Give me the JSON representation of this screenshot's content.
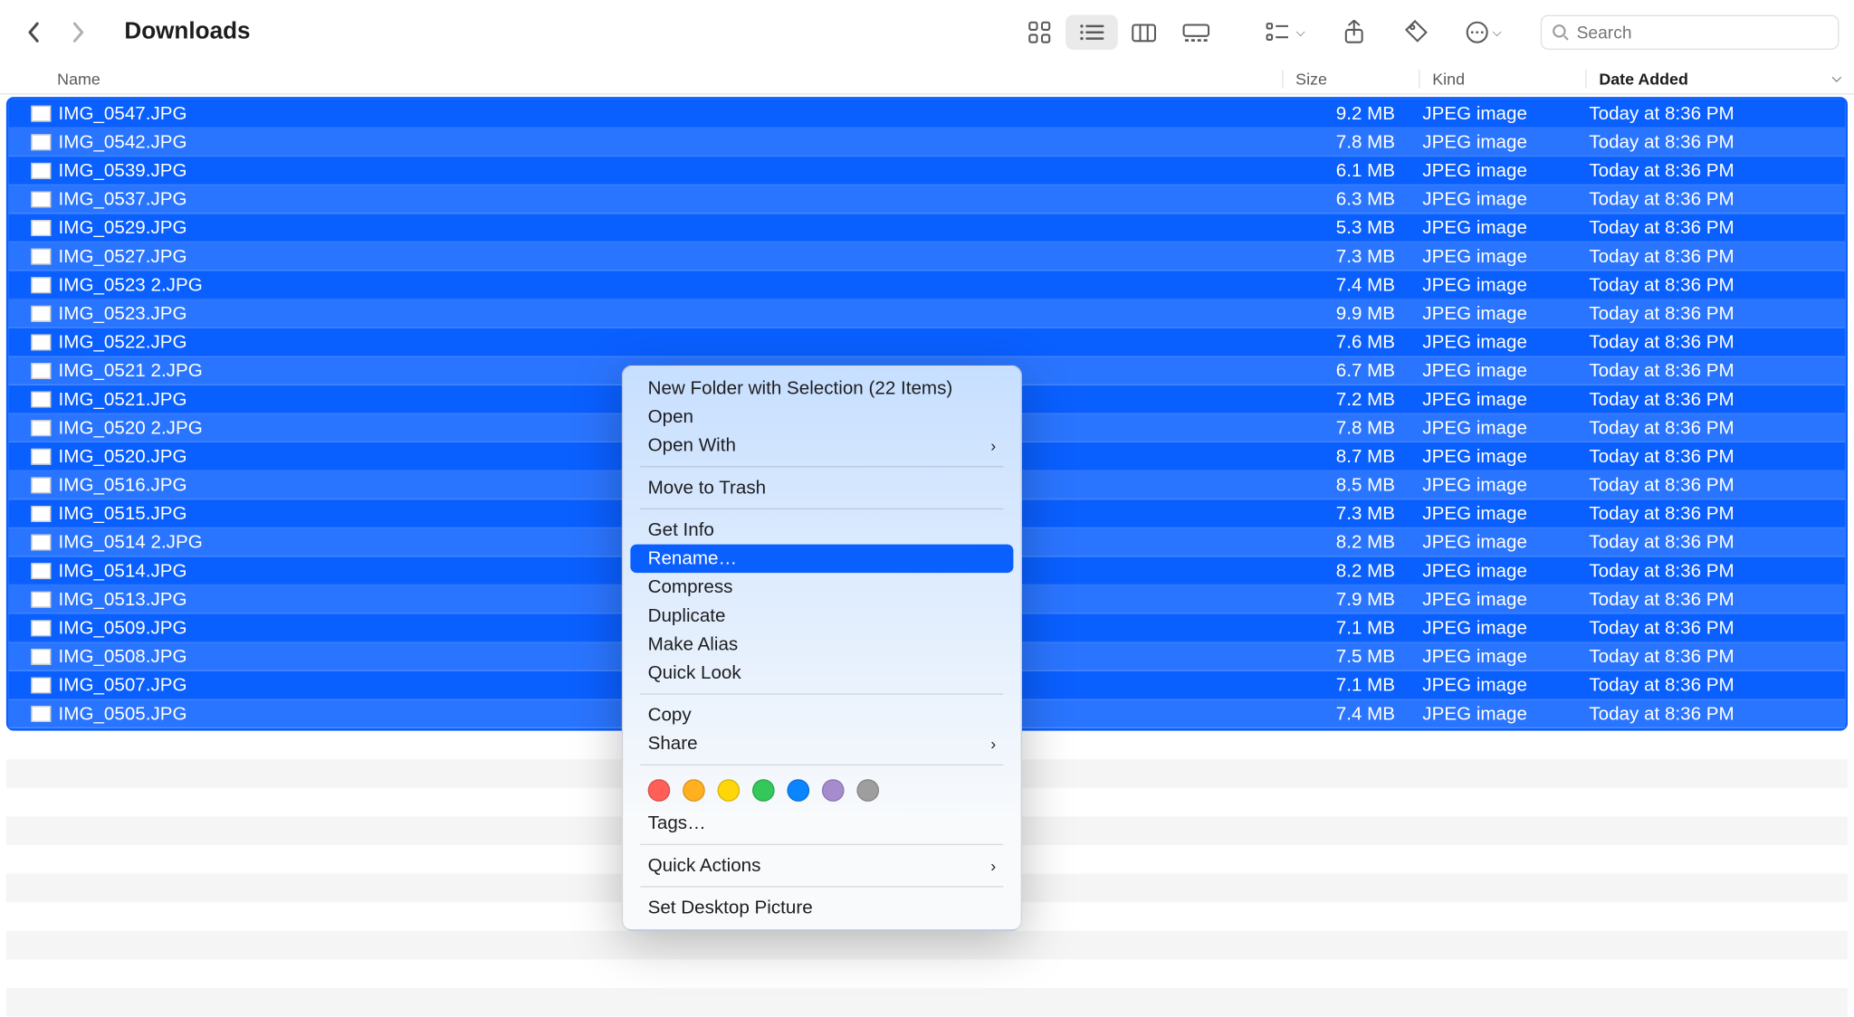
{
  "window": {
    "title": "Downloads"
  },
  "toolbar": {
    "search_placeholder": "Search"
  },
  "columns": {
    "name": "Name",
    "size": "Size",
    "kind": "Kind",
    "date_added": "Date Added"
  },
  "files": [
    {
      "name": "IMG_0547.JPG",
      "size": "9.2 MB",
      "kind": "JPEG image",
      "date": "Today at 8:36 PM"
    },
    {
      "name": "IMG_0542.JPG",
      "size": "7.8 MB",
      "kind": "JPEG image",
      "date": "Today at 8:36 PM"
    },
    {
      "name": "IMG_0539.JPG",
      "size": "6.1 MB",
      "kind": "JPEG image",
      "date": "Today at 8:36 PM"
    },
    {
      "name": "IMG_0537.JPG",
      "size": "6.3 MB",
      "kind": "JPEG image",
      "date": "Today at 8:36 PM"
    },
    {
      "name": "IMG_0529.JPG",
      "size": "5.3 MB",
      "kind": "JPEG image",
      "date": "Today at 8:36 PM"
    },
    {
      "name": "IMG_0527.JPG",
      "size": "7.3 MB",
      "kind": "JPEG image",
      "date": "Today at 8:36 PM"
    },
    {
      "name": "IMG_0523 2.JPG",
      "size": "7.4 MB",
      "kind": "JPEG image",
      "date": "Today at 8:36 PM"
    },
    {
      "name": "IMG_0523.JPG",
      "size": "9.9 MB",
      "kind": "JPEG image",
      "date": "Today at 8:36 PM"
    },
    {
      "name": "IMG_0522.JPG",
      "size": "7.6 MB",
      "kind": "JPEG image",
      "date": "Today at 8:36 PM"
    },
    {
      "name": "IMG_0521 2.JPG",
      "size": "6.7 MB",
      "kind": "JPEG image",
      "date": "Today at 8:36 PM"
    },
    {
      "name": "IMG_0521.JPG",
      "size": "7.2 MB",
      "kind": "JPEG image",
      "date": "Today at 8:36 PM"
    },
    {
      "name": "IMG_0520 2.JPG",
      "size": "7.8 MB",
      "kind": "JPEG image",
      "date": "Today at 8:36 PM"
    },
    {
      "name": "IMG_0520.JPG",
      "size": "8.7 MB",
      "kind": "JPEG image",
      "date": "Today at 8:36 PM"
    },
    {
      "name": "IMG_0516.JPG",
      "size": "8.5 MB",
      "kind": "JPEG image",
      "date": "Today at 8:36 PM"
    },
    {
      "name": "IMG_0515.JPG",
      "size": "7.3 MB",
      "kind": "JPEG image",
      "date": "Today at 8:36 PM"
    },
    {
      "name": "IMG_0514 2.JPG",
      "size": "8.2 MB",
      "kind": "JPEG image",
      "date": "Today at 8:36 PM"
    },
    {
      "name": "IMG_0514.JPG",
      "size": "8.2 MB",
      "kind": "JPEG image",
      "date": "Today at 8:36 PM"
    },
    {
      "name": "IMG_0513.JPG",
      "size": "7.9 MB",
      "kind": "JPEG image",
      "date": "Today at 8:36 PM"
    },
    {
      "name": "IMG_0509.JPG",
      "size": "7.1 MB",
      "kind": "JPEG image",
      "date": "Today at 8:36 PM"
    },
    {
      "name": "IMG_0508.JPG",
      "size": "7.5 MB",
      "kind": "JPEG image",
      "date": "Today at 8:36 PM"
    },
    {
      "name": "IMG_0507.JPG",
      "size": "7.1 MB",
      "kind": "JPEG image",
      "date": "Today at 8:36 PM"
    },
    {
      "name": "IMG_0505.JPG",
      "size": "7.4 MB",
      "kind": "JPEG image",
      "date": "Today at 8:36 PM"
    }
  ],
  "context_menu": {
    "items": [
      {
        "label": "New Folder with Selection (22 Items)"
      },
      {
        "label": "Open"
      },
      {
        "label": "Open With",
        "submenu": true
      },
      {
        "separator": true
      },
      {
        "label": "Move to Trash"
      },
      {
        "separator": true
      },
      {
        "label": "Get Info"
      },
      {
        "label": "Rename…",
        "highlight": true
      },
      {
        "label": "Compress"
      },
      {
        "label": "Duplicate"
      },
      {
        "label": "Make Alias"
      },
      {
        "label": "Quick Look"
      },
      {
        "separator": true
      },
      {
        "label": "Copy"
      },
      {
        "label": "Share",
        "submenu": true
      },
      {
        "separator": true
      },
      {
        "tags": true
      },
      {
        "label": "Tags…"
      },
      {
        "separator": true
      },
      {
        "label": "Quick Actions",
        "submenu": true
      },
      {
        "separator": true
      },
      {
        "label": "Set Desktop Picture"
      }
    ],
    "tag_colors": [
      "#ff5f57",
      "#ffb020",
      "#ffd60a",
      "#34c759",
      "#0a84ff",
      "#a78bcf",
      "#9e9e9e"
    ]
  }
}
